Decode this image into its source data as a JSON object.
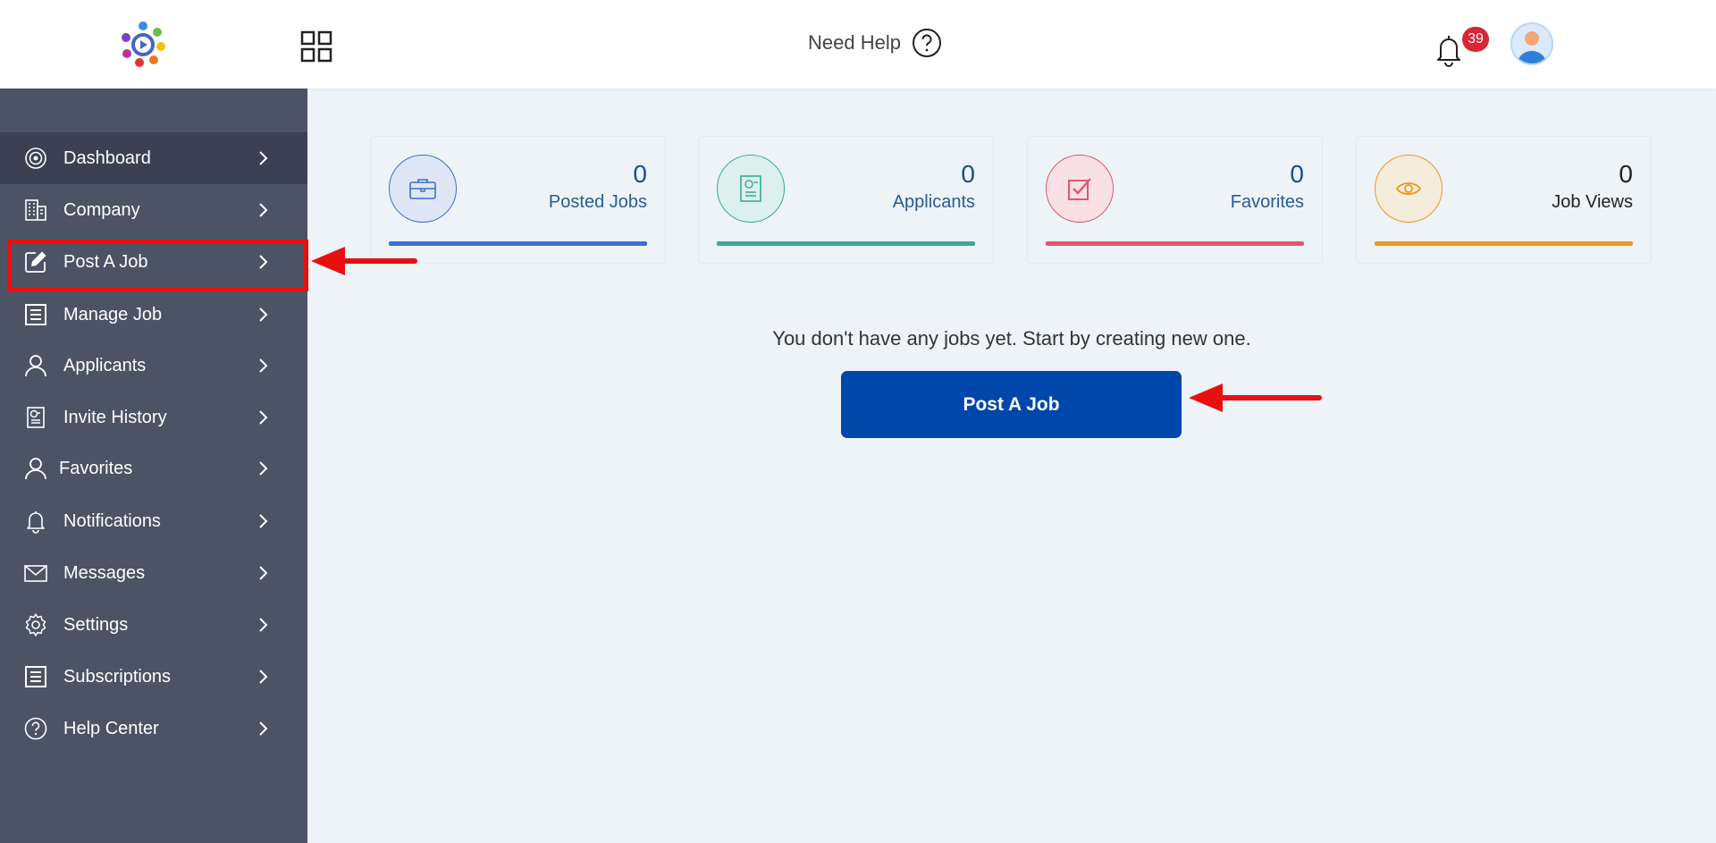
{
  "header": {
    "need_help_label": "Need Help",
    "notification_count": "39"
  },
  "sidebar": {
    "items": [
      {
        "label": "Dashboard",
        "icon": "dashboard-icon"
      },
      {
        "label": "Company",
        "icon": "building-icon"
      },
      {
        "label": "Post A Job",
        "icon": "edit-icon"
      },
      {
        "label": "Manage Job",
        "icon": "list-icon"
      },
      {
        "label": "Applicants",
        "icon": "user-icon"
      },
      {
        "label": "Invite History",
        "icon": "invite-doc-icon"
      },
      {
        "label": "Favorites",
        "icon": "user-icon"
      },
      {
        "label": "Notifications",
        "icon": "bell-icon"
      },
      {
        "label": "Messages",
        "icon": "mail-icon"
      },
      {
        "label": "Settings",
        "icon": "gear-icon"
      },
      {
        "label": "Subscriptions",
        "icon": "list-icon"
      },
      {
        "label": "Help Center",
        "icon": "question-icon"
      }
    ]
  },
  "stats": [
    {
      "value": "0",
      "label": "Posted Jobs",
      "color": "#3c6fd1",
      "icon": "briefcase-icon"
    },
    {
      "value": "0",
      "label": "Applicants",
      "color": "#3aa99a",
      "icon": "resume-icon"
    },
    {
      "value": "0",
      "label": "Favorites",
      "color": "#e2566f",
      "icon": "checkbox-icon"
    },
    {
      "value": "0",
      "label": "Job Views",
      "color": "#e89a25",
      "icon": "eye-icon"
    }
  ],
  "main": {
    "empty_message": "You don't have any jobs yet. Start by creating new one.",
    "post_button_label": "Post A Job"
  },
  "colors": {
    "sidebar_bg": "#4c5365",
    "sidebar_active": "#3b4152",
    "primary_button": "#0047ab",
    "annotation_red": "#ea0f0f"
  }
}
